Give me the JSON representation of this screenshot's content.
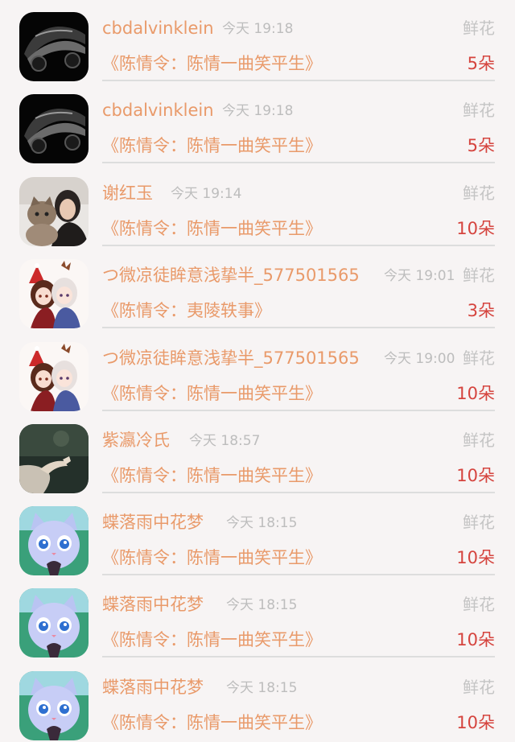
{
  "records": [
    {
      "user": "cbdalvinklein",
      "time": "今天 19:18",
      "gift_type": "鲜花",
      "work": "《陈情令：陈情一曲笑平生》",
      "amount": "5朵",
      "avatar": "car-avatar"
    },
    {
      "user": "cbdalvinklein",
      "time": "今天 19:18",
      "gift_type": "鲜花",
      "work": "《陈情令：陈情一曲笑平生》",
      "amount": "5朵",
      "avatar": "car-avatar"
    },
    {
      "user": "谢红玉",
      "time": "今天 19:14",
      "gift_type": "鲜花",
      "work": "《陈情令：陈情一曲笑平生》",
      "amount": "10朵",
      "avatar": "woman-with-cat-avatar"
    },
    {
      "user": "つ微凉徒眸意浅挚半_577501565",
      "time": "今天 19:01",
      "gift_type": "鲜花",
      "work": "《陈情令：夷陵轶事》",
      "amount": "3朵",
      "avatar": "anime-couple-avatar"
    },
    {
      "user": "つ微凉徒眸意浅挚半_577501565",
      "time": "今天 19:00",
      "gift_type": "鲜花",
      "work": "《陈情令：陈情一曲笑平生》",
      "amount": "10朵",
      "avatar": "anime-couple-avatar"
    },
    {
      "user": "紫瀛冷氏",
      "time": "今天 18:57",
      "gift_type": "鲜花",
      "work": "《陈情令：陈情一曲笑平生》",
      "amount": "10朵",
      "avatar": "dark-hand-avatar"
    },
    {
      "user": "蝶落雨中花梦",
      "time": "今天 18:15",
      "gift_type": "鲜花",
      "work": "《陈情令：陈情一曲笑平生》",
      "amount": "10朵",
      "avatar": "blue-cat-avatar"
    },
    {
      "user": "蝶落雨中花梦",
      "time": "今天 18:15",
      "gift_type": "鲜花",
      "work": "《陈情令：陈情一曲笑平生》",
      "amount": "10朵",
      "avatar": "blue-cat-avatar"
    },
    {
      "user": "蝶落雨中花梦",
      "time": "今天 18:15",
      "gift_type": "鲜花",
      "work": "《陈情令：陈情一曲笑平生》",
      "amount": "10朵",
      "avatar": "blue-cat-avatar"
    }
  ],
  "colors": {
    "username": "#e99a6a",
    "work_title": "#e99a6a",
    "amount": "#d5443e",
    "muted": "#bdbdbd",
    "background": "#f7f4f4"
  }
}
